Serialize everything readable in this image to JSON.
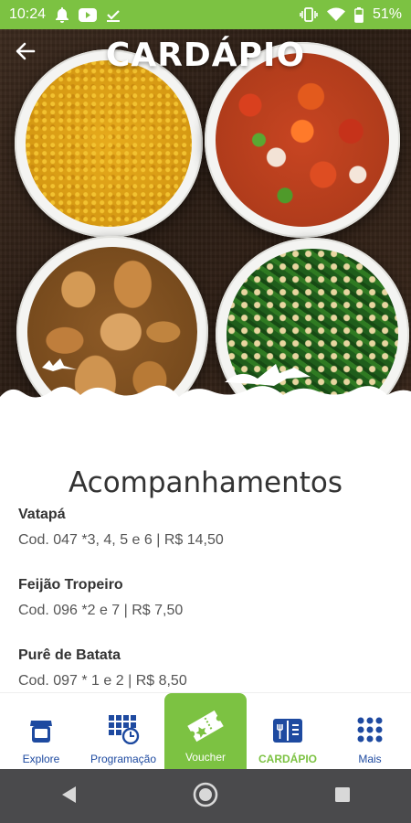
{
  "status_bar": {
    "time": "10:24",
    "battery": "51%",
    "icons_left": [
      "bell-icon",
      "youtube-icon",
      "download-done-icon"
    ],
    "icons_right": [
      "vibrate-icon",
      "wifi-icon",
      "battery-icon"
    ]
  },
  "header": {
    "title": "CARDÁPIO",
    "back_icon": "arrow-left-icon"
  },
  "section": {
    "title": "Acompanhamentos"
  },
  "menu_items": [
    {
      "name": "Vatapá",
      "description": "Cod. 047 *3, 4, 5 e 6 | R$ 14,50"
    },
    {
      "name": "Feijão Tropeiro",
      "description": "Cod. 096 *2 e 7 | R$ 7,50"
    },
    {
      "name": "Purê de Batata",
      "description": "Cod. 097 * 1 e 2 | R$ 8,50"
    }
  ],
  "tabs": [
    {
      "label": "Explore",
      "icon": "storefront-icon"
    },
    {
      "label": "Programação",
      "icon": "calendar-clock-icon"
    },
    {
      "label": "Voucher",
      "icon": "ticket-icon"
    },
    {
      "label": "CARDÁPIO",
      "icon": "menu-book-icon"
    },
    {
      "label": "Mais",
      "icon": "grid-dots-icon"
    }
  ],
  "active_tab": "CARDÁPIO",
  "colors": {
    "brand_green": "#7cc242",
    "brand_blue": "#1e4aa0",
    "nav_bar": "#4a4a4c"
  }
}
